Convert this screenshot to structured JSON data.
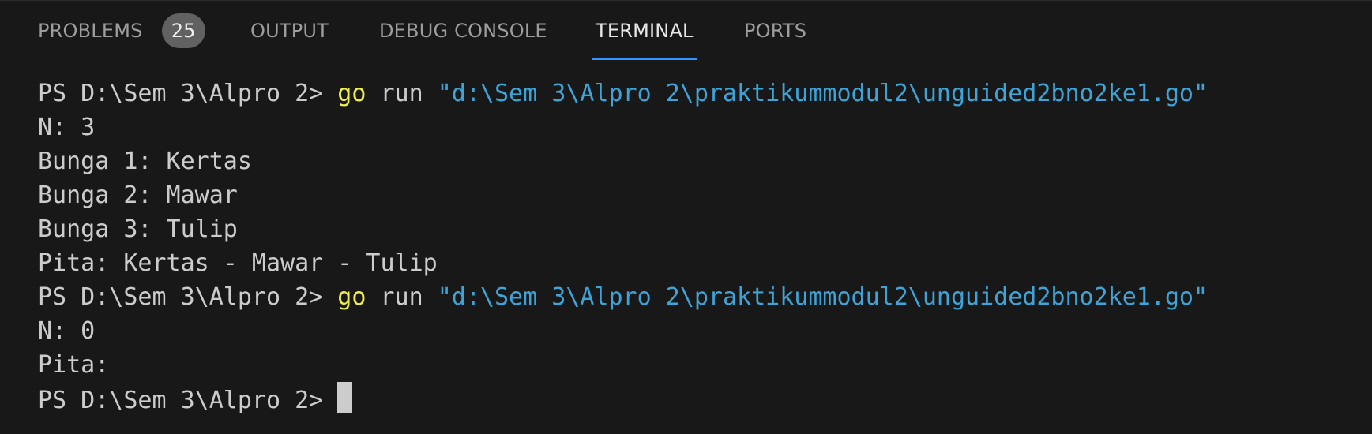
{
  "tabs": {
    "problems": {
      "label": "PROBLEMS",
      "badge": "25"
    },
    "output": {
      "label": "OUTPUT"
    },
    "debug_console": {
      "label": "DEBUG CONSOLE"
    },
    "terminal": {
      "label": "TERMINAL",
      "active": true
    },
    "ports": {
      "label": "PORTS"
    }
  },
  "terminal": {
    "lines": [
      {
        "prompt": "PS D:\\Sem 3\\Alpro 2> ",
        "command": "go",
        "args": " run ",
        "string": "\"d:\\Sem 3\\Alpro 2\\praktikummodul2\\unguided2bno2ke1.go\""
      },
      {
        "text": "N: 3"
      },
      {
        "text": "Bunga 1: Kertas"
      },
      {
        "text": "Bunga 2: Mawar"
      },
      {
        "text": "Bunga 3: Tulip"
      },
      {
        "text": "Pita: Kertas - Mawar - Tulip"
      },
      {
        "prompt": "PS D:\\Sem 3\\Alpro 2> ",
        "command": "go",
        "args": " run ",
        "string": "\"d:\\Sem 3\\Alpro 2\\praktikummodul2\\unguided2bno2ke1.go\""
      },
      {
        "text": "N: 0"
      },
      {
        "text": "Pita:"
      },
      {
        "prompt": "PS D:\\Sem 3\\Alpro 2> "
      }
    ]
  },
  "colors": {
    "background": "#181818",
    "text": "#cccccc",
    "command": "#f0f04d",
    "string": "#3ea4d8",
    "active_tab_underline": "#3794ff",
    "badge_bg": "#616161"
  }
}
